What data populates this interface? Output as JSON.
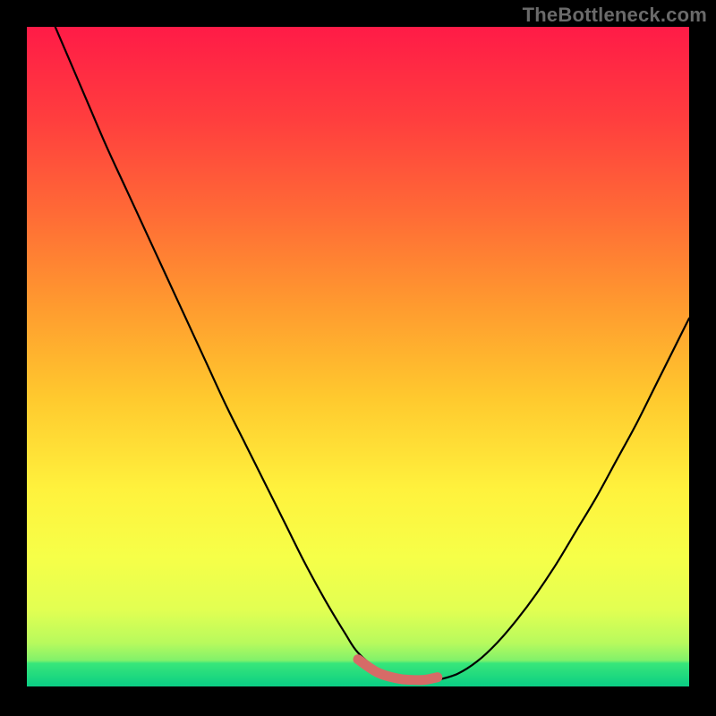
{
  "watermark": "TheBottleneck.com",
  "colors": {
    "gradient_top": "#ff1b47",
    "gradient_upper": "#ff5a3a",
    "gradient_mid": "#ffb12f",
    "gradient_lower": "#fff23d",
    "gradient_lowish": "#f0ff4a",
    "gradient_green1": "#cfff57",
    "gradient_green2": "#7af06c",
    "gradient_green3": "#1fd97f",
    "curve_stroke": "#000000",
    "marker_fill": "#d66b67"
  },
  "chart_data": {
    "type": "line",
    "title": "",
    "xlabel": "",
    "ylabel": "",
    "xlim": [
      0,
      100
    ],
    "ylim": [
      0,
      100
    ],
    "grid": false,
    "legend": false,
    "series": [
      {
        "name": "bottleneck-curve",
        "x": [
          0,
          3,
          6,
          9,
          12,
          15,
          18,
          21,
          24,
          27,
          30,
          33,
          36,
          39,
          42,
          45,
          48,
          50,
          53,
          56,
          58,
          60,
          62,
          65,
          68,
          71,
          74,
          77,
          80,
          83,
          86,
          89,
          92,
          95,
          98,
          100
        ],
        "y": [
          110,
          103,
          96,
          89,
          82,
          75.5,
          69,
          62.5,
          56,
          49.5,
          43,
          37,
          31,
          25,
          19,
          13.5,
          8.5,
          5.5,
          3,
          1.6,
          1.2,
          1.2,
          1.4,
          2.3,
          4.2,
          7,
          10.5,
          14.5,
          19,
          24,
          29,
          34.5,
          40,
          46,
          52,
          56
        ]
      },
      {
        "name": "flat-region-marker",
        "x": [
          50,
          53,
          56,
          58,
          60,
          62
        ],
        "y": [
          4.5,
          2.5,
          1.6,
          1.4,
          1.4,
          1.8
        ]
      }
    ]
  }
}
